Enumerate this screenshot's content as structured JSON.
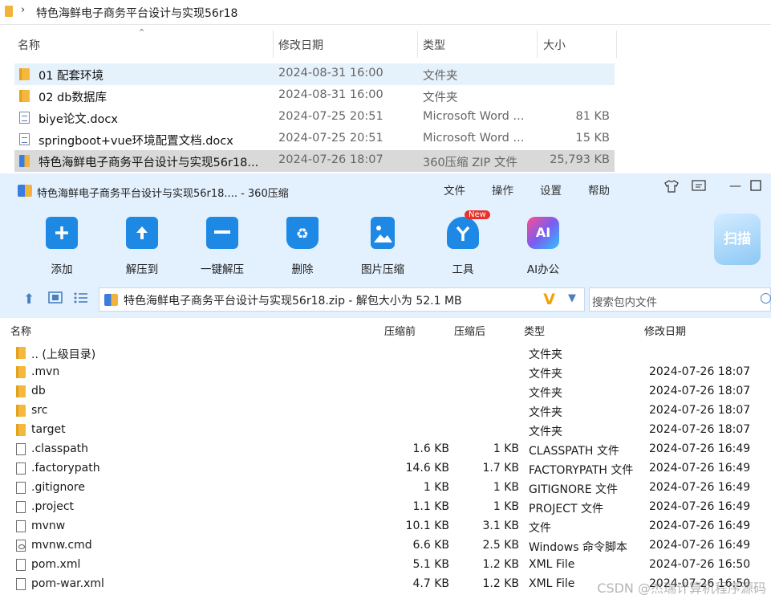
{
  "explorer": {
    "breadcrumb": "特色海鲜电子商务平台设计与实现56r18",
    "columns": {
      "name": "名称",
      "modified": "修改日期",
      "type": "类型",
      "size": "大小"
    },
    "rows": [
      {
        "name": "01 配套环境",
        "modified": "2024-08-31 16:00",
        "type": "文件夹",
        "size": "",
        "icon": "folder-icon"
      },
      {
        "name": "02 db数据库",
        "modified": "2024-08-31 16:00",
        "type": "文件夹",
        "size": "",
        "icon": "folder-icon"
      },
      {
        "name": "biye论文.docx",
        "modified": "2024-07-25 20:51",
        "type": "Microsoft Word ...",
        "size": "81 KB",
        "icon": "word-doc-icon"
      },
      {
        "name": "springboot+vue环境配置文档.docx",
        "modified": "2024-07-25 20:51",
        "type": "Microsoft Word ...",
        "size": "15 KB",
        "icon": "word-doc-icon"
      },
      {
        "name": "特色海鲜电子商务平台设计与实现56r18...",
        "modified": "2024-07-26 18:07",
        "type": "360压缩 ZIP 文件",
        "size": "25,793 KB",
        "icon": "zip-archive-icon"
      }
    ]
  },
  "archiver": {
    "title": "特色海鲜电子商务平台设计与实现56r18.... - 360压缩",
    "menu": [
      "文件",
      "操作",
      "设置",
      "帮助"
    ],
    "toolbar": [
      {
        "label": "添加",
        "icon": "add-icon",
        "color": "#1e88e5"
      },
      {
        "label": "解压到",
        "icon": "extract-to-icon",
        "color": "#1e88e5"
      },
      {
        "label": "一键解压",
        "icon": "one-click-extract-icon",
        "color": "#1e88e5"
      },
      {
        "label": "删除",
        "icon": "delete-icon",
        "color": "#1e88e5"
      },
      {
        "label": "图片压缩",
        "icon": "image-compress-icon",
        "color": "#1e88e5"
      },
      {
        "label": "工具",
        "icon": "tools-icon",
        "color": "#1e88e5",
        "badge": "New"
      },
      {
        "label": "AI办公",
        "icon": "ai-office-icon",
        "color": "#7b5cf0",
        "glyph": "AI"
      }
    ],
    "scan_label": "扫描",
    "address": "特色海鲜电子商务平台设计与实现56r18.zip - 解包大小为 52.1 MB",
    "search_placeholder": "搜索包内文件",
    "columns": {
      "name": "名称",
      "before": "压缩前",
      "after": "压缩后",
      "type": "类型",
      "modified": "修改日期"
    },
    "rows": [
      {
        "name": ".. (上级目录)",
        "before": "",
        "after": "",
        "type": "文件夹",
        "modified": "",
        "icon": "folder-icon"
      },
      {
        "name": ".mvn",
        "before": "",
        "after": "",
        "type": "文件夹",
        "modified": "2024-07-26 18:07",
        "icon": "folder-icon"
      },
      {
        "name": "db",
        "before": "",
        "after": "",
        "type": "文件夹",
        "modified": "2024-07-26 18:07",
        "icon": "folder-icon"
      },
      {
        "name": "src",
        "before": "",
        "after": "",
        "type": "文件夹",
        "modified": "2024-07-26 18:07",
        "icon": "folder-icon"
      },
      {
        "name": "target",
        "before": "",
        "after": "",
        "type": "文件夹",
        "modified": "2024-07-26 18:07",
        "icon": "folder-icon"
      },
      {
        "name": ".classpath",
        "before": "1.6 KB",
        "after": "1 KB",
        "type": "CLASSPATH 文件",
        "modified": "2024-07-26 16:49",
        "icon": "file-icon"
      },
      {
        "name": ".factorypath",
        "before": "14.6 KB",
        "after": "1.7 KB",
        "type": "FACTORYPATH 文件",
        "modified": "2024-07-26 16:49",
        "icon": "file-icon"
      },
      {
        "name": ".gitignore",
        "before": "1 KB",
        "after": "1 KB",
        "type": "GITIGNORE 文件",
        "modified": "2024-07-26 16:49",
        "icon": "file-icon"
      },
      {
        "name": ".project",
        "before": "1.1 KB",
        "after": "1 KB",
        "type": "PROJECT 文件",
        "modified": "2024-07-26 16:49",
        "icon": "file-icon"
      },
      {
        "name": "mvnw",
        "before": "10.1 KB",
        "after": "3.1 KB",
        "type": "文件",
        "modified": "2024-07-26 16:49",
        "icon": "file-icon"
      },
      {
        "name": "mvnw.cmd",
        "before": "6.6 KB",
        "after": "2.5 KB",
        "type": "Windows 命令脚本",
        "modified": "2024-07-26 16:49",
        "icon": "cmd-script-icon"
      },
      {
        "name": "pom.xml",
        "before": "5.1 KB",
        "after": "1.2 KB",
        "type": "XML File",
        "modified": "2024-07-26 16:50",
        "icon": "file-icon"
      },
      {
        "name": "pom-war.xml",
        "before": "4.7 KB",
        "after": "1.2 KB",
        "type": "XML File",
        "modified": "2024-07-26 16:50",
        "icon": "file-icon"
      }
    ]
  },
  "watermark": "CSDN @杰瑞计算机程序源码"
}
